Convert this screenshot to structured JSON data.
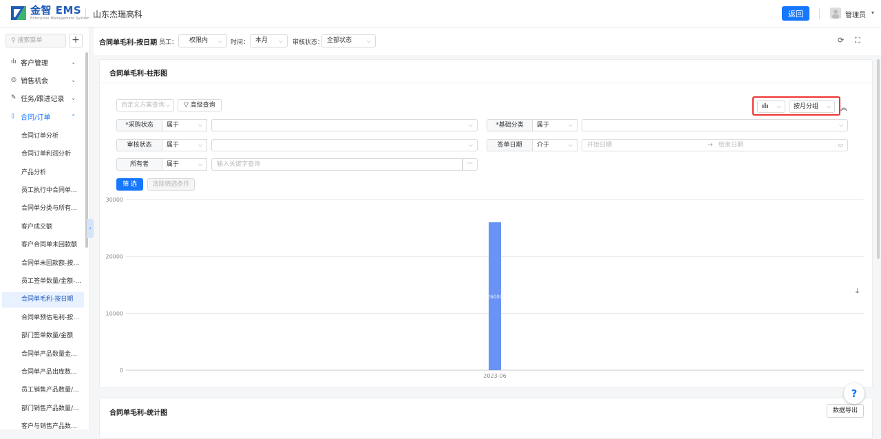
{
  "header": {
    "logo_text": "金智 EMS",
    "logo_subtitle": "Enterprise Management System",
    "company": "山东杰瑞高科",
    "back_label": "返回",
    "user_name": "管理员"
  },
  "sidebar": {
    "search_placeholder": "搜索菜单",
    "add_label": "+",
    "groups": [
      {
        "label": "客户管理",
        "icon": "bar-chart-icon"
      },
      {
        "label": "销售机会",
        "icon": "target-icon"
      },
      {
        "label": "任务/跟进记录",
        "icon": "pin-icon"
      },
      {
        "label": "合同/订单",
        "icon": "document-icon"
      }
    ],
    "items": [
      "合同订单分析",
      "合同订单利润分析",
      "产品分析",
      "员工执行中合同单...",
      "合同单分类与所有...",
      "客户成交额",
      "客户合同单未回款额",
      "合同单未回款额-按...",
      "员工签单数量/金额-...",
      "合同单毛利-按日期",
      "合同单预估毛利-按...",
      "部门签单数量/金额",
      "合同单产品数量金...",
      "合同单产品出库数...",
      "员工销售产品数量/...",
      "部门销售产品数量/...",
      "客户与销售产品数..."
    ]
  },
  "filterbar": {
    "title": "合同单毛利-按日期",
    "employee_label": "员工：",
    "employee_value": "权限内",
    "time_label": "时间：",
    "time_value": "本月",
    "audit_label": "审核状态：",
    "audit_value": "全部状态"
  },
  "panel": {
    "title": "合同单毛利-柱形图",
    "custom_query_placeholder": "自定义方案查询",
    "advanced_query": "高级查询",
    "chart_type_icon": "bar-chart-icon",
    "group_by": "按月分组",
    "conditions": [
      {
        "label": "*采购状态",
        "op": "属于",
        "value": ""
      },
      {
        "label": "*基础分类",
        "op": "属于",
        "value": ""
      },
      {
        "label": "审核状态",
        "op": "属于",
        "value": ""
      },
      {
        "label": "签单日期",
        "op": "介于",
        "start_placeholder": "开始日期",
        "end_placeholder": "结束日期"
      },
      {
        "label": "所有者",
        "op": "属于",
        "placeholder": "输入关键字查询"
      }
    ],
    "filter_button": "筛 选",
    "clear_button": "清除筛选条件"
  },
  "chart_data": {
    "type": "bar",
    "categories": [
      "2023-06"
    ],
    "values": [
      26000
    ],
    "data_labels": [
      "26000"
    ],
    "ylim": [
      0,
      30000
    ],
    "yticks": [
      0,
      10000,
      20000,
      30000
    ],
    "grid": true,
    "color": "#6b93f5"
  },
  "panel2": {
    "title": "合同单毛利-统计图",
    "export_label": "数据导出"
  },
  "help_label": "?"
}
